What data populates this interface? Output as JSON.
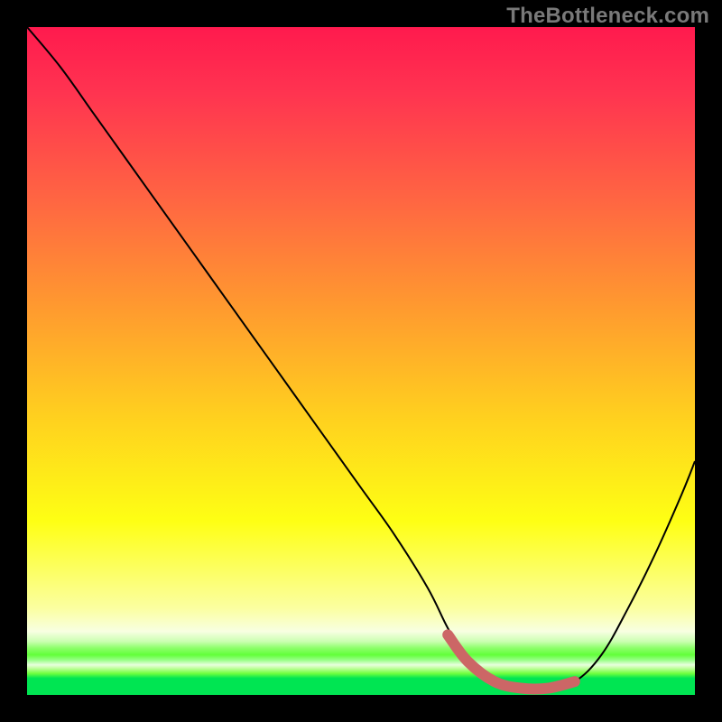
{
  "watermark": "TheBottleneck.com",
  "chart_data": {
    "type": "line",
    "title": "",
    "xlabel": "",
    "ylabel": "",
    "xlim": [
      0,
      100
    ],
    "ylim": [
      0,
      100
    ],
    "series": [
      {
        "name": "bottleneck-curve",
        "x": [
          0,
          5,
          10,
          15,
          20,
          25,
          30,
          35,
          40,
          45,
          50,
          55,
          60,
          63,
          66,
          70,
          74,
          78,
          82,
          86,
          90,
          94,
          98,
          100
        ],
        "values": [
          100,
          94,
          87,
          80,
          73,
          66,
          59,
          52,
          45,
          38,
          31,
          24,
          16,
          10,
          5,
          2,
          1,
          1,
          2,
          6,
          13,
          21,
          30,
          35
        ]
      }
    ],
    "highlight": {
      "name": "optimal-trough",
      "x": [
        63,
        66,
        70,
        74,
        78,
        82
      ],
      "values": [
        9,
        5,
        2,
        1,
        1,
        2
      ],
      "color": "#cc6666"
    },
    "gradient_stops": [
      {
        "pct": 0,
        "color": "#ff1a4e"
      },
      {
        "pct": 50,
        "color": "#ffcf1f"
      },
      {
        "pct": 90,
        "color": "#fbffa0"
      },
      {
        "pct": 97,
        "color": "#00e552"
      }
    ]
  }
}
